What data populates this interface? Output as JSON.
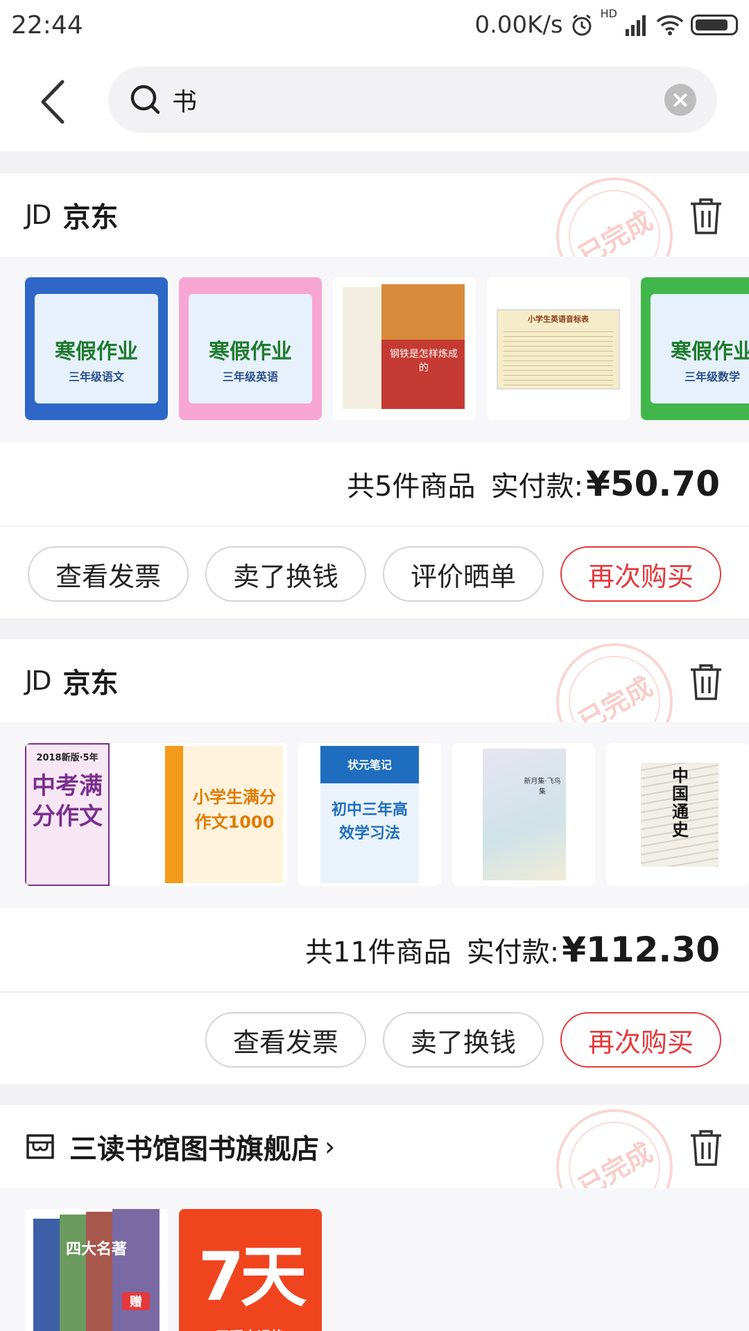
{
  "status_bar": {
    "time": "22:44",
    "speed": "0.00K/s",
    "network": "HD"
  },
  "search": {
    "query": "书",
    "clear_label": "×"
  },
  "orders": [
    {
      "shop": {
        "logo": "JD",
        "name": "京东",
        "arrow": ""
      },
      "stamp": "已完成",
      "products": [
        {
          "title": "寒假作业",
          "sub": "三年级语文",
          "cover": "#2f67c8",
          "bg": "#e6f1fb"
        },
        {
          "title": "寒假作业",
          "sub": "三年级英语",
          "cover": "#f7a5d3",
          "bg": "#e6f1fb"
        },
        {
          "title": "钢铁是怎样炼成的",
          "sub": "",
          "cover": "#c53a32",
          "bg": "#f3efe0"
        },
        {
          "title": "小学生英语音标表",
          "sub": "",
          "cover": "#f2f2f2",
          "bg": "#f6ecc9"
        },
        {
          "title": "寒假作业",
          "sub": "三年级数学",
          "cover": "#41b64a",
          "bg": "#e6f1fb"
        }
      ],
      "count_text": "共5件商品",
      "pay_label": "实付款:",
      "price": "¥50.70",
      "actions": [
        "查看发票",
        "卖了换钱",
        "评价晒单",
        "再次购买"
      ]
    },
    {
      "shop": {
        "logo": "JD",
        "name": "京东",
        "arrow": ""
      },
      "stamp": "已完成",
      "products": [
        {
          "title": "中考满分作文",
          "sub": "2018新版·5年",
          "cover": "#7b2f8f",
          "bg": "#ffffff"
        },
        {
          "title": "小学生满分作文1000",
          "sub": "",
          "cover": "#f39a1b",
          "bg": "#ffffff"
        },
        {
          "title": "初中三年高效学习法",
          "sub": "状元笔记",
          "cover": "#1f6dbf",
          "bg": "#ffffff"
        },
        {
          "title": "新月集·飞鸟集",
          "sub": "",
          "cover": "#d9d3e8",
          "bg": "#ffffff"
        },
        {
          "title": "中国通史",
          "sub": "",
          "cover": "#e7e2d8",
          "bg": "#ffffff"
        }
      ],
      "count_text": "共11件商品",
      "pay_label": "实付款:",
      "price": "¥112.30",
      "actions": [
        "查看发票",
        "卖了换钱",
        "再次购买"
      ]
    },
    {
      "shop": {
        "logo": "",
        "name": "三读书馆图书旗舰店",
        "arrow": "›"
      },
      "stamp": "已完成",
      "products": [
        {
          "title": "四大名著",
          "sub": "赠",
          "cover": "#3d5fa8",
          "bg": "#ffffff"
        },
        {
          "title": "7天",
          "sub": "无理由退换",
          "cover": "#f0441f",
          "bg": "#f0441f"
        }
      ]
    }
  ]
}
